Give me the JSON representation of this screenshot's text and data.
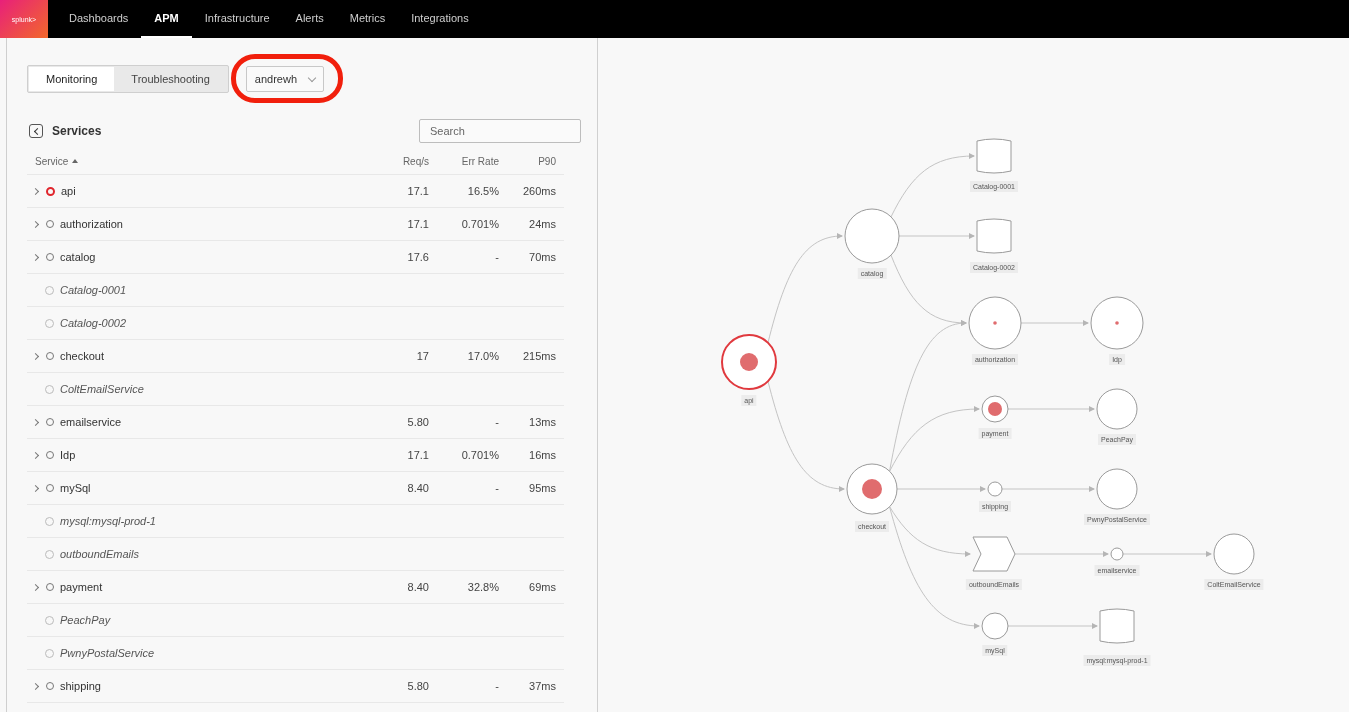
{
  "nav": {
    "logo": "splunk>",
    "items": [
      {
        "label": "Dashboards",
        "selected": false
      },
      {
        "label": "APM",
        "selected": true
      },
      {
        "label": "Infrastructure",
        "selected": false
      },
      {
        "label": "Alerts",
        "selected": false
      },
      {
        "label": "Metrics",
        "selected": false
      },
      {
        "label": "Integrations",
        "selected": false
      }
    ]
  },
  "view_tabs": [
    {
      "label": "Monitoring",
      "selected": true
    },
    {
      "label": "Troubleshooting",
      "selected": false
    }
  ],
  "environment": {
    "value": "andrewh",
    "highlighted": true
  },
  "services": {
    "title": "Services",
    "search": {
      "placeholder": "Search"
    },
    "columns": [
      {
        "label": "Service",
        "sorted": true
      },
      {
        "label": "Req/s",
        "sorted": false
      },
      {
        "label": "Err Rate",
        "sorted": false
      },
      {
        "label": "P90",
        "sorted": false
      }
    ],
    "rows": [
      {
        "kind": "service",
        "name": "api",
        "expanded": false,
        "alert": true,
        "req": "17.1",
        "err": "16.5%",
        "p90": "260ms"
      },
      {
        "kind": "service",
        "name": "authorization",
        "expanded": false,
        "alert": false,
        "req": "17.1",
        "err": "0.701%",
        "p90": "24ms"
      },
      {
        "kind": "service",
        "name": "catalog",
        "expanded": false,
        "alert": false,
        "req": "17.6",
        "err": "-",
        "p90": "70ms"
      },
      {
        "kind": "inferred",
        "name": "Catalog-0001"
      },
      {
        "kind": "inferred",
        "name": "Catalog-0002"
      },
      {
        "kind": "service",
        "name": "checkout",
        "expanded": false,
        "alert": false,
        "req": "17",
        "err": "17.0%",
        "p90": "215ms"
      },
      {
        "kind": "inferred",
        "name": "ColtEmailService"
      },
      {
        "kind": "service",
        "name": "emailservice",
        "expanded": false,
        "alert": false,
        "req": "5.80",
        "err": "-",
        "p90": "13ms"
      },
      {
        "kind": "service",
        "name": "Idp",
        "expanded": false,
        "alert": false,
        "req": "17.1",
        "err": "0.701%",
        "p90": "16ms"
      },
      {
        "kind": "service",
        "name": "mySql",
        "expanded": false,
        "alert": false,
        "req": "8.40",
        "err": "-",
        "p90": "95ms"
      },
      {
        "kind": "inferred",
        "name": "mysql:mysql-prod-1"
      },
      {
        "kind": "inferred",
        "name": "outboundEmails"
      },
      {
        "kind": "service",
        "name": "payment",
        "expanded": false,
        "alert": false,
        "req": "8.40",
        "err": "32.8%",
        "p90": "69ms"
      },
      {
        "kind": "inferred",
        "name": "PeachPay"
      },
      {
        "kind": "inferred",
        "name": "PwnyPostalService"
      },
      {
        "kind": "service",
        "name": "shipping",
        "expanded": false,
        "alert": false,
        "req": "5.80",
        "err": "-",
        "p90": "37ms"
      }
    ]
  },
  "service_map": {
    "nodes": [
      {
        "label": "api",
        "kind": "service",
        "errors": true,
        "root_cause": true
      },
      {
        "label": "catalog",
        "kind": "service",
        "errors": false,
        "root_cause": false
      },
      {
        "label": "Catalog-0001",
        "kind": "database",
        "root_cause": false
      },
      {
        "label": "Catalog-0002",
        "kind": "database",
        "root_cause": false
      },
      {
        "label": "authorization",
        "kind": "service",
        "errors": true,
        "root_cause": false
      },
      {
        "label": "Idp",
        "kind": "service",
        "errors": true,
        "root_cause": false
      },
      {
        "label": "payment",
        "kind": "service",
        "errors": true,
        "root_cause": false
      },
      {
        "label": "PeachPay",
        "kind": "service",
        "errors": false,
        "root_cause": false
      },
      {
        "label": "checkout",
        "kind": "service",
        "errors": true,
        "root_cause": false
      },
      {
        "label": "shipping",
        "kind": "service",
        "errors": false,
        "root_cause": false
      },
      {
        "label": "PwnyPostalService",
        "kind": "service",
        "errors": false,
        "root_cause": false
      },
      {
        "label": "outboundEmails",
        "kind": "queue",
        "root_cause": false
      },
      {
        "label": "emailservice",
        "kind": "service",
        "errors": false,
        "root_cause": false
      },
      {
        "label": "ColtEmailService",
        "kind": "service",
        "errors": false,
        "root_cause": false
      },
      {
        "label": "mySql",
        "kind": "service",
        "errors": false,
        "root_cause": false
      },
      {
        "label": "mysql:mysql-prod-1",
        "kind": "database",
        "root_cause": false
      }
    ]
  }
}
